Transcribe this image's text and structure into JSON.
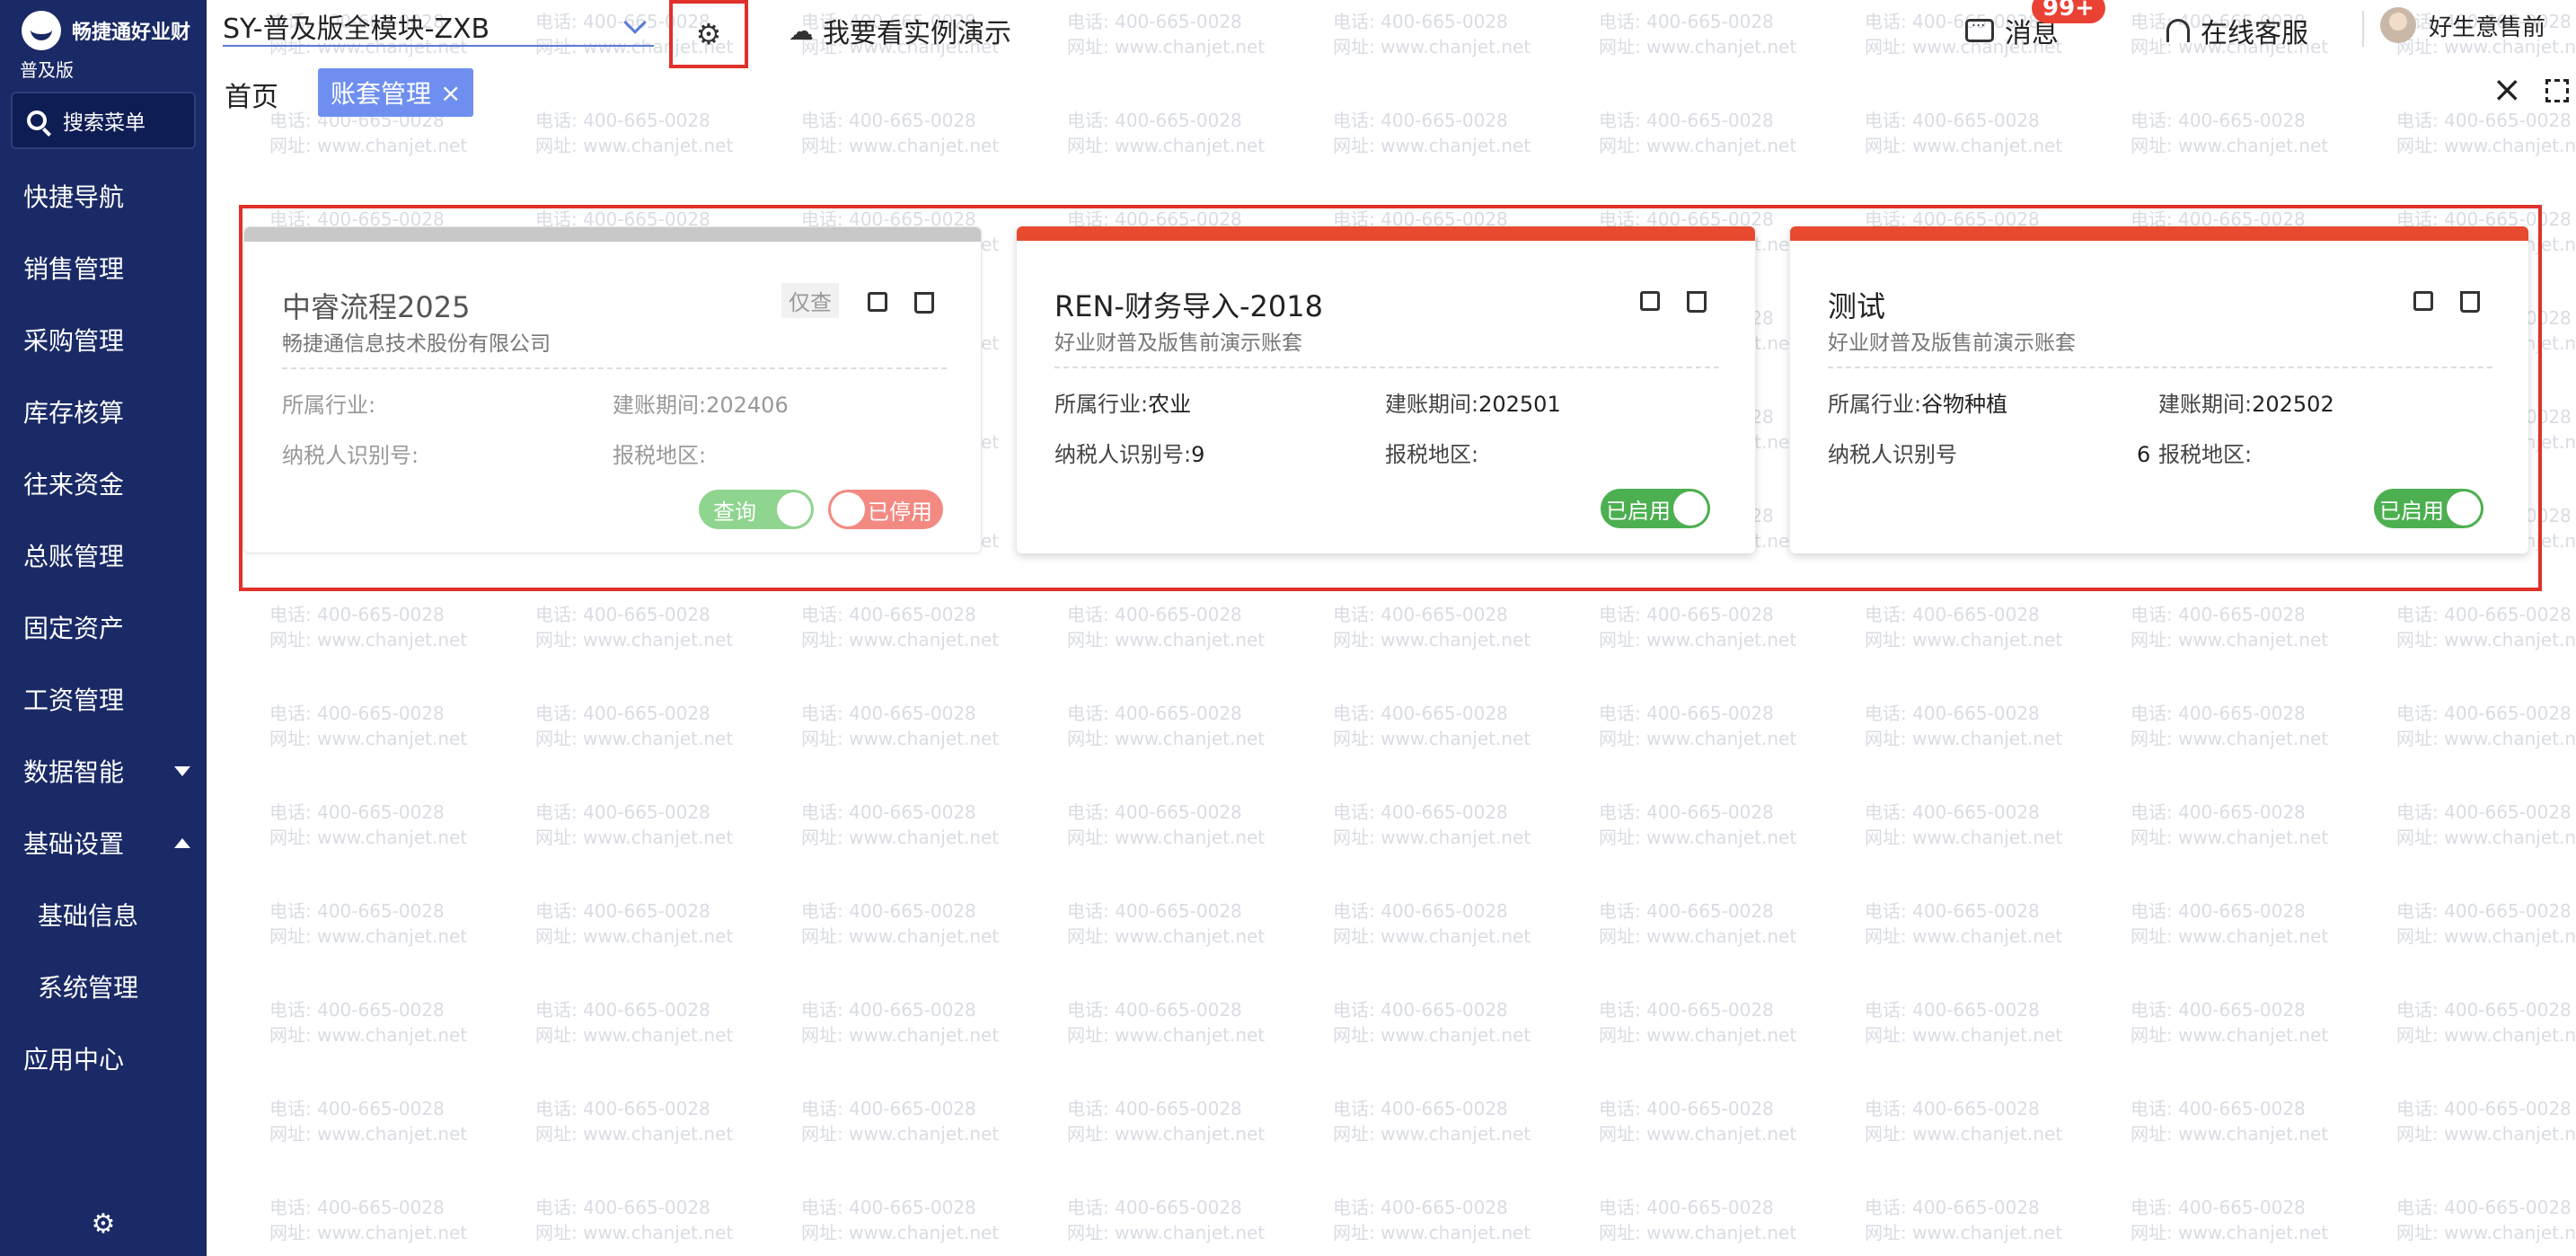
{
  "sidebar": {
    "brand": "畅捷通好业财",
    "edition": "普及版",
    "search_label": "搜索菜单",
    "items": [
      {
        "label": "快捷导航"
      },
      {
        "label": "销售管理"
      },
      {
        "label": "采购管理"
      },
      {
        "label": "库存核算"
      },
      {
        "label": "往来资金"
      },
      {
        "label": "总账管理"
      },
      {
        "label": "固定资产"
      },
      {
        "label": "工资管理"
      },
      {
        "label": "数据智能"
      },
      {
        "label": "基础设置"
      },
      {
        "label": "基础信息"
      },
      {
        "label": "系统管理"
      },
      {
        "label": "应用中心"
      }
    ]
  },
  "header": {
    "ledger_name": "SY-普及版全模块-ZXB",
    "demo_label": "我要看实例演示",
    "messages_label": "消息",
    "messages_badge": "99+",
    "support_label": "在线客服",
    "user_name": "好生意售前"
  },
  "tabs": {
    "home": "首页",
    "active": "账套管理",
    "active_close": "×",
    "close_all": "×"
  },
  "watermark": {
    "line1": "电话: 400-665-0028",
    "line2": "网址: www.chanjet.net"
  },
  "cards": [
    {
      "name": "中睿流程2025",
      "company": "畅捷通信息技术股份有限公司",
      "readonly_tag": "仅查",
      "industry_label": "所属行业:",
      "industry_value": "",
      "period_label": "建账期间:",
      "period_value": "202406",
      "taxid_label": "纳税人识别号:",
      "taxid_value": "",
      "region_label": "报税地区:",
      "region_value": "",
      "toggle1_label": "查询",
      "toggle2_label": "已停用",
      "status": "disabled",
      "strip_color": "#c8c8c8"
    },
    {
      "name": "REN-财务导入-2018",
      "company": "好业财普及版售前演示账套",
      "industry_label": "所属行业:",
      "industry_value": "农业",
      "period_label": "建账期间:",
      "period_value": "202501",
      "taxid_label": "纳税人识别号:",
      "taxid_value": "9",
      "region_label": "报税地区:",
      "region_value": "",
      "toggle_label": "已启用",
      "status": "enabled",
      "strip_color": "#e84a2f"
    },
    {
      "name": "测试",
      "company": "好业财普及版售前演示账套",
      "industry_label": "所属行业:",
      "industry_value": "谷物种植",
      "period_label": "建账期间:",
      "period_value": "202502",
      "taxid_label": "纳税人识别号",
      "taxid_value": "6",
      "region_label": "报税地区:",
      "region_value": "",
      "toggle_label": "已启用",
      "status": "enabled",
      "strip_color": "#e84a2f"
    }
  ],
  "colors": {
    "sidebar_bg": "#1a2a66",
    "accent_blue": "#6f8ff0",
    "highlight_red": "#e0312b",
    "enabled_green": "#4caf50",
    "card_strip_red": "#e84a2f"
  }
}
